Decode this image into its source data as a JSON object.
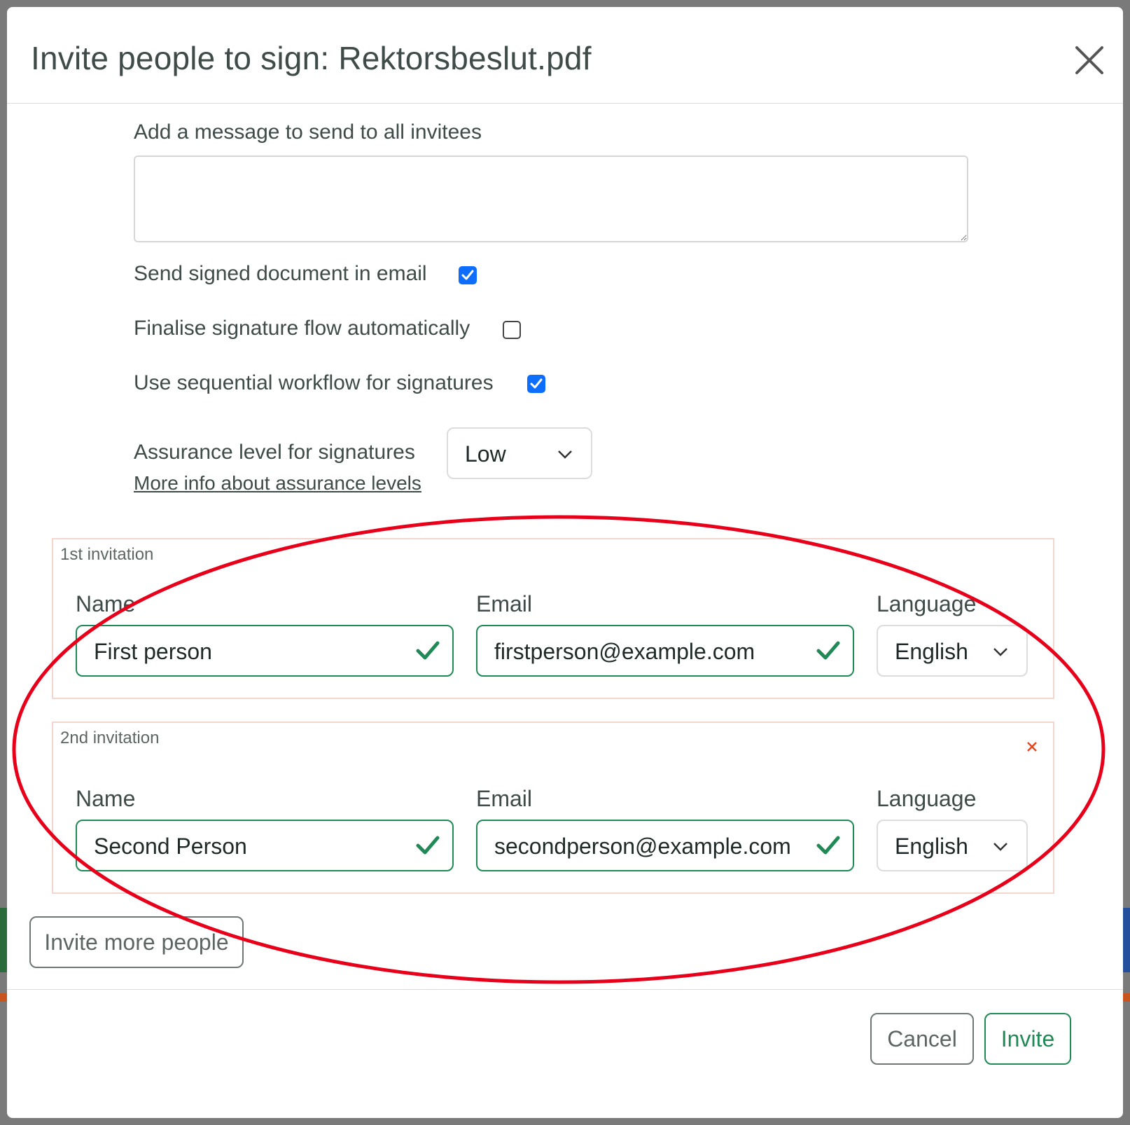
{
  "modal": {
    "title": "Invite people to sign: Rektorsbeslut.pdf"
  },
  "message": {
    "label": "Add a message to send to all invitees",
    "value": ""
  },
  "options": {
    "send_signed": {
      "label": "Send signed document in email",
      "checked": true
    },
    "finalise_auto": {
      "label": "Finalise signature flow automatically",
      "checked": false
    },
    "sequential": {
      "label": "Use sequential workflow for signatures",
      "checked": true
    }
  },
  "assurance": {
    "label": "Assurance level for signatures",
    "value": "Low",
    "link": "More info about assurance levels"
  },
  "invitations": [
    {
      "legend": "1st invitation",
      "name_label": "Name",
      "name_value": "First person",
      "email_label": "Email",
      "email_value": "firstperson@example.com",
      "language_label": "Language",
      "language_value": "English"
    },
    {
      "legend": "2nd invitation",
      "name_label": "Name",
      "name_value": "Second Person",
      "email_label": "Email",
      "email_value": "secondperson@example.com",
      "language_label": "Language",
      "language_value": "English"
    }
  ],
  "buttons": {
    "invite_more": "Invite more people",
    "cancel": "Cancel",
    "invite": "Invite"
  },
  "colors": {
    "valid": "#1f8a55",
    "checkbox": "#0d6efd",
    "remove": "#e8461c",
    "annotation": "#e8001b"
  }
}
